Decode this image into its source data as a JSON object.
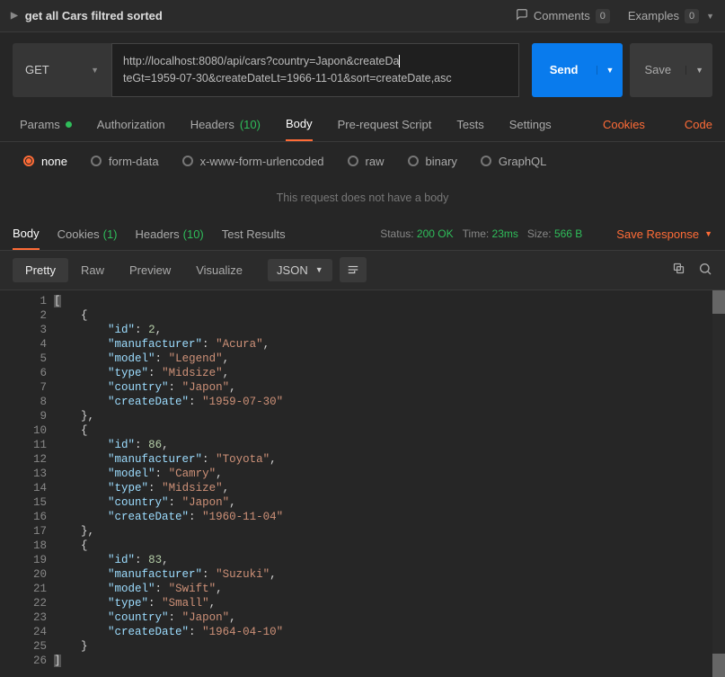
{
  "header": {
    "request_name": "get all Cars filtred sorted",
    "comments_label": "Comments",
    "comments_count": "0",
    "examples_label": "Examples",
    "examples_count": "0"
  },
  "request": {
    "method": "GET",
    "url_line1": "http://localhost:8080/api/cars?country=Japon&createDa",
    "url_line2": "teGt=1959-07-30&createDateLt=1966-11-01&sort=createDate,asc",
    "send_label": "Send",
    "save_label": "Save"
  },
  "tabs": {
    "params": "Params",
    "authorization": "Authorization",
    "headers": "Headers",
    "headers_count": "(10)",
    "body": "Body",
    "prerequest": "Pre-request Script",
    "tests": "Tests",
    "settings": "Settings",
    "cookies_link": "Cookies",
    "code_link": "Code"
  },
  "body_types": {
    "none": "none",
    "formdata": "form-data",
    "xwww": "x-www-form-urlencoded",
    "raw": "raw",
    "binary": "binary",
    "graphql": "GraphQL"
  },
  "empty_body_text": "This request does not have a body",
  "resp_tabs": {
    "body": "Body",
    "cookies": "Cookies",
    "cookies_count": "(1)",
    "headers": "Headers",
    "headers_count": "(10)",
    "test_results": "Test Results"
  },
  "resp_meta": {
    "status_label": "Status:",
    "status_value": "200 OK",
    "time_label": "Time:",
    "time_value": "23ms",
    "size_label": "Size:",
    "size_value": "566 B",
    "save_response": "Save Response"
  },
  "viewer": {
    "pretty": "Pretty",
    "raw": "Raw",
    "preview": "Preview",
    "visualize": "Visualize",
    "format": "JSON"
  },
  "response_body": [
    {
      "id": 2,
      "manufacturer": "Acura",
      "model": "Legend",
      "type": "Midsize",
      "country": "Japon",
      "createDate": "1959-07-30"
    },
    {
      "id": 86,
      "manufacturer": "Toyota",
      "model": "Camry",
      "type": "Midsize",
      "country": "Japon",
      "createDate": "1960-11-04"
    },
    {
      "id": 83,
      "manufacturer": "Suzuki",
      "model": "Swift",
      "type": "Small",
      "country": "Japon",
      "createDate": "1964-04-10"
    }
  ]
}
